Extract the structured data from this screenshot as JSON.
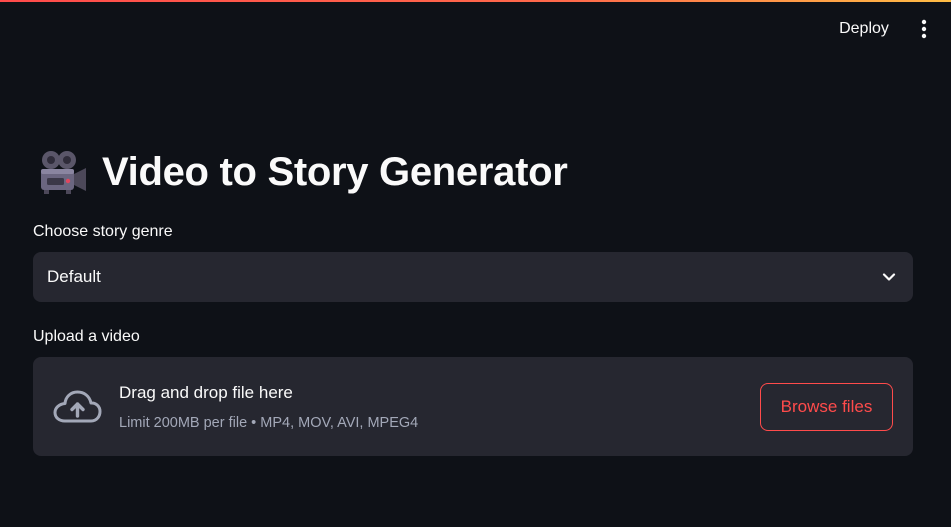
{
  "header": {
    "deploy_label": "Deploy",
    "menu_icon": "more-vertical-icon"
  },
  "main": {
    "title_icon": "movie-camera-icon",
    "title": "Video to Story Generator",
    "genre": {
      "label": "Choose story genre",
      "selected": "Default",
      "dropdown_icon": "chevron-down-icon"
    },
    "upload": {
      "label": "Upload a video",
      "icon": "cloud-upload-icon",
      "drop_title": "Drag and drop file here",
      "limit_text": "Limit 200MB per file • MP4, MOV, AVI, MPEG4",
      "browse_label": "Browse files"
    }
  },
  "colors": {
    "background": "#0e1117",
    "surface": "#262730",
    "accent": "#ff4b4b",
    "text": "#fafafa",
    "muted_text": "#a3a8b8"
  }
}
